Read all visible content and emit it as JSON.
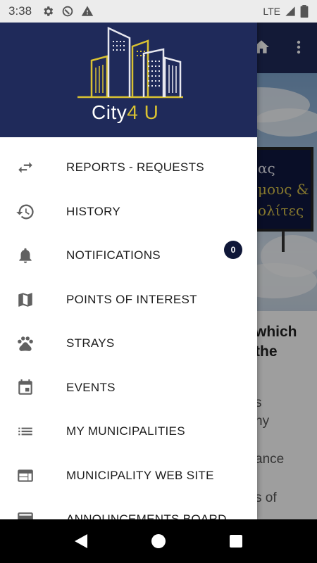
{
  "status_bar": {
    "time": "3:38",
    "network": "LTE",
    "icons_left": [
      "gear-icon",
      "sync-icon",
      "warning-icon"
    ],
    "icons_right": [
      "signal-icon",
      "battery-icon"
    ]
  },
  "background_app": {
    "billboard_lines": [
      "ας",
      "μους &",
      "ολίτες"
    ],
    "heading_lines": [
      "which",
      "the"
    ],
    "body_lines": [
      "s",
      "ny",
      "ance",
      "s of"
    ]
  },
  "drawer": {
    "logo": {
      "brand": "City",
      "accent": "4 U"
    },
    "items": [
      {
        "label": "REPORTS - REQUESTS",
        "icon": "swap-arrows-icon"
      },
      {
        "label": "HISTORY",
        "icon": "history-icon"
      },
      {
        "label": "NOTIFICATIONS",
        "icon": "bell-icon",
        "badge": "0"
      },
      {
        "label": "POINTS OF INTEREST",
        "icon": "map-icon"
      },
      {
        "label": "STRAYS",
        "icon": "paw-icon"
      },
      {
        "label": "EVENTS",
        "icon": "calendar-icon"
      },
      {
        "label": "MY MUNICIPALITIES",
        "icon": "list-icon"
      },
      {
        "label": "MUNICIPALITY WEB SITE",
        "icon": "web-icon"
      },
      {
        "label": "ANNOUNCEMENTS BOARD",
        "icon": "board-icon"
      }
    ]
  },
  "colors": {
    "primary": "#1f2a5a",
    "accent": "#d9c232",
    "badge": "#0f1738",
    "text": "#1d1d1d",
    "icon": "#616161"
  }
}
